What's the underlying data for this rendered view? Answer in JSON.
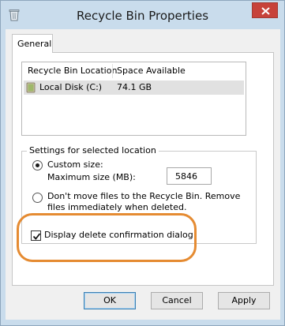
{
  "window": {
    "title": "Recycle Bin Properties",
    "icons": {
      "app": "recycle-bin-icon",
      "close": "close-icon"
    }
  },
  "tabs": [
    {
      "label": "General",
      "selected": true
    }
  ],
  "location_list": {
    "columns": [
      "Recycle Bin Location",
      "Space Available"
    ],
    "rows": [
      {
        "location": "Local Disk (C:)",
        "space": "74.1 GB",
        "selected": true,
        "icon": "drive-icon"
      }
    ]
  },
  "settings": {
    "group_title": "Settings for selected location",
    "custom_size_label": "Custom size:",
    "custom_size_selected": true,
    "max_size_label": "Maximum size (MB):",
    "max_size_value": "5846",
    "dont_move_label": "Don't move files to the Recycle Bin. Remove files immediately when deleted.",
    "dont_move_selected": false
  },
  "confirm_dialog": {
    "label": "Display delete confirmation dialog",
    "checked": true,
    "highlight_color": "#e58b32"
  },
  "buttons": {
    "ok": "OK",
    "cancel": "Cancel",
    "apply": "Apply"
  },
  "colors": {
    "frame": "#c9dcec",
    "close": "#c7423a",
    "selection": "#e1e1e1"
  }
}
